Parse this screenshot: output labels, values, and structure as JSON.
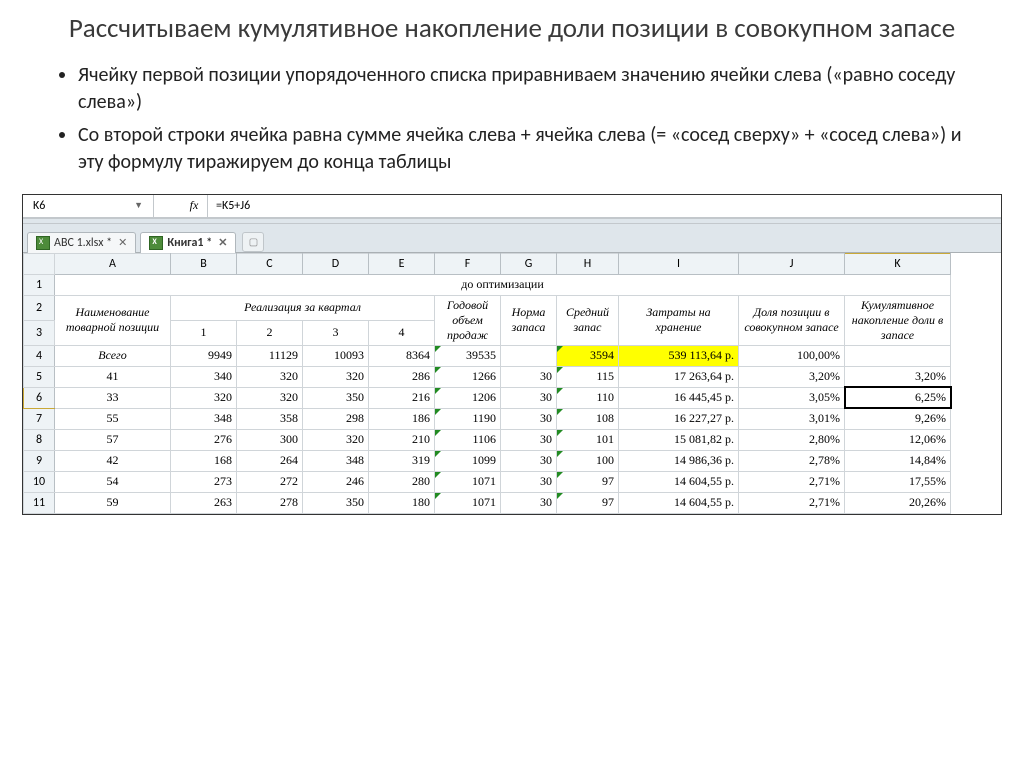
{
  "title": "Рассчитываем кумулятивное накопление доли позиции в совокупном запасе",
  "bullets": [
    "Ячейку первой позиции упорядоченного списка приравниваем значению ячейки слева («равно соседу слева»)",
    "Со второй строки ячейка равна сумме ячейка слева + ячейка слева (= «сосед сверху» + «сосед слева») и эту формулу тиражируем до конца таблицы"
  ],
  "namebox": "K6",
  "fx_label": "fx",
  "formula": "=K5+J6",
  "tabs": {
    "t1": "ABC 1.xlsx *",
    "t2": "Книга1 *",
    "close": "✕"
  },
  "cols": [
    "A",
    "B",
    "C",
    "D",
    "E",
    "F",
    "G",
    "H",
    "I",
    "J",
    "K"
  ],
  "rownums": [
    "1",
    "2",
    "3",
    "4",
    "5",
    "6",
    "7",
    "8",
    "9",
    "10",
    "11"
  ],
  "headers": {
    "section": "до оптимизации",
    "name": "Наименование товарной позиции",
    "realiz": "Реализация за квартал",
    "q1": "1",
    "q2": "2",
    "q3": "3",
    "q4": "4",
    "year": "Годовой объем продаж",
    "norma": "Норма запаса",
    "avg": "Средний запас",
    "cost": "Затраты на хранение",
    "share": "Доля позиции в совокупном запасе",
    "cumul": "Кумулятивное накопление доли в запасе"
  },
  "total_label": "Всего",
  "chart_data": {
    "type": "table",
    "columns": [
      "Наименование",
      "Q1",
      "Q2",
      "Q3",
      "Q4",
      "Годовой объем",
      "Норма запаса",
      "Средний запас",
      "Затраты",
      "Доля",
      "Кумулятивное"
    ],
    "rows": [
      {
        "name": "Всего",
        "q1": 9949,
        "q2": 11129,
        "q3": 10093,
        "q4": 8364,
        "year": 39535,
        "norma": "",
        "avg": 3594,
        "cost": "539 113,64 р.",
        "share": "100,00%",
        "cumul": ""
      },
      {
        "name": 41,
        "q1": 340,
        "q2": 320,
        "q3": 320,
        "q4": 286,
        "year": 1266,
        "norma": 30,
        "avg": 115,
        "cost": "17 263,64 р.",
        "share": "3,20%",
        "cumul": "3,20%"
      },
      {
        "name": 33,
        "q1": 320,
        "q2": 320,
        "q3": 350,
        "q4": 216,
        "year": 1206,
        "norma": 30,
        "avg": 110,
        "cost": "16 445,45 р.",
        "share": "3,05%",
        "cumul": "6,25%"
      },
      {
        "name": 55,
        "q1": 348,
        "q2": 358,
        "q3": 298,
        "q4": 186,
        "year": 1190,
        "norma": 30,
        "avg": 108,
        "cost": "16 227,27 р.",
        "share": "3,01%",
        "cumul": "9,26%"
      },
      {
        "name": 57,
        "q1": 276,
        "q2": 300,
        "q3": 320,
        "q4": 210,
        "year": 1106,
        "norma": 30,
        "avg": 101,
        "cost": "15 081,82 р.",
        "share": "2,80%",
        "cumul": "12,06%"
      },
      {
        "name": 42,
        "q1": 168,
        "q2": 264,
        "q3": 348,
        "q4": 319,
        "year": 1099,
        "norma": 30,
        "avg": 100,
        "cost": "14 986,36 р.",
        "share": "2,78%",
        "cumul": "14,84%"
      },
      {
        "name": 54,
        "q1": 273,
        "q2": 272,
        "q3": 246,
        "q4": 280,
        "year": 1071,
        "norma": 30,
        "avg": 97,
        "cost": "14 604,55 р.",
        "share": "2,71%",
        "cumul": "17,55%"
      },
      {
        "name": 59,
        "q1": 263,
        "q2": 278,
        "q3": 350,
        "q4": 180,
        "year": 1071,
        "norma": 30,
        "avg": 97,
        "cost": "14 604,55 р.",
        "share": "2,71%",
        "cumul": "20,26%"
      }
    ]
  }
}
